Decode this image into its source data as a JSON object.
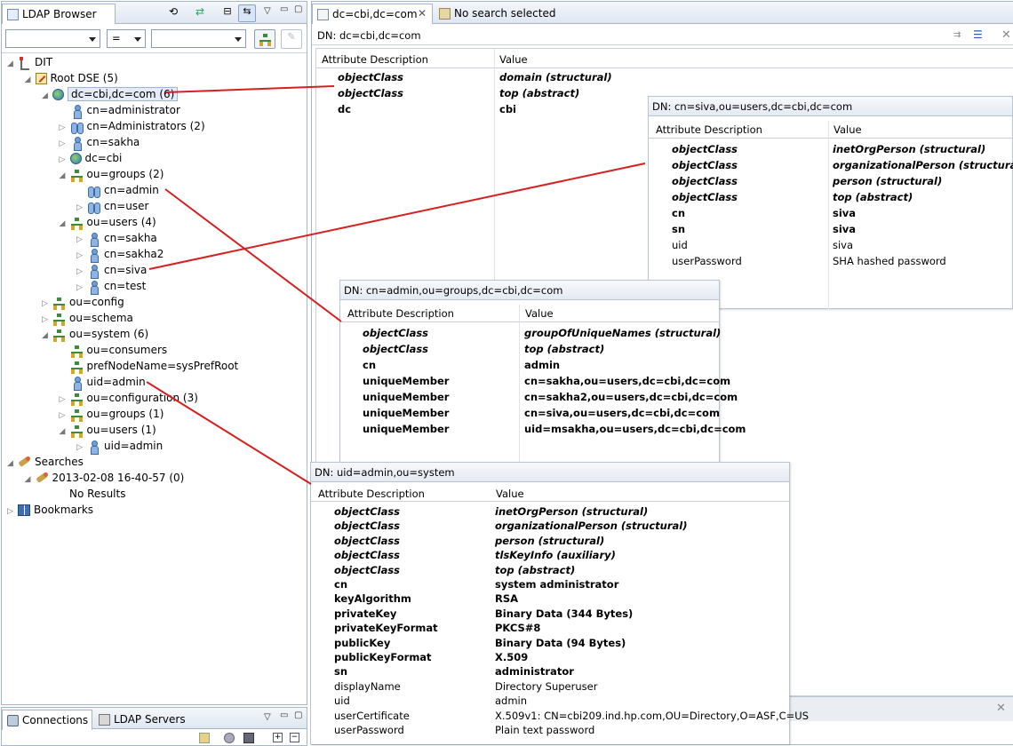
{
  "left_panel": {
    "tab_title": "LDAP Browser",
    "filter_operator": "=",
    "tree": [
      {
        "label": "DIT",
        "level": 0,
        "icon": "dit-icon",
        "expanded": true
      },
      {
        "label": "Root DSE (5)",
        "level": 1,
        "icon": "root-dse-icon",
        "expanded": true
      },
      {
        "label": "dc=cbi,dc=com (6)",
        "level": 2,
        "icon": "globe-icon",
        "expanded": true,
        "selected": true
      },
      {
        "label": "cn=administrator",
        "level": 3,
        "icon": "person-icon"
      },
      {
        "label": "cn=Administrators (2)",
        "level": 3,
        "icon": "group-icon",
        "expandable": true
      },
      {
        "label": "cn=sakha",
        "level": 3,
        "icon": "person-icon",
        "expandable": true
      },
      {
        "label": "dc=cbi",
        "level": 3,
        "icon": "globe-icon",
        "expandable": true
      },
      {
        "label": "ou=groups (2)",
        "level": 3,
        "icon": "ou-icon",
        "expanded": true
      },
      {
        "label": "cn=admin",
        "level": 4,
        "icon": "group-icon"
      },
      {
        "label": "cn=user",
        "level": 4,
        "icon": "group-icon",
        "expandable": true
      },
      {
        "label": "ou=users (4)",
        "level": 3,
        "icon": "ou-icon",
        "expanded": true
      },
      {
        "label": "cn=sakha",
        "level": 4,
        "icon": "person-icon",
        "expandable": true
      },
      {
        "label": "cn=sakha2",
        "level": 4,
        "icon": "person-icon",
        "expandable": true
      },
      {
        "label": "cn=siva",
        "level": 4,
        "icon": "person-icon",
        "expandable": true
      },
      {
        "label": "cn=test",
        "level": 4,
        "icon": "person-icon",
        "expandable": true
      },
      {
        "label": "ou=config",
        "level": 2,
        "icon": "ou-icon",
        "expandable": true
      },
      {
        "label": "ou=schema",
        "level": 2,
        "icon": "ou-icon",
        "expandable": true
      },
      {
        "label": "ou=system (6)",
        "level": 2,
        "icon": "ou-icon",
        "expanded": true
      },
      {
        "label": "ou=consumers",
        "level": 3,
        "icon": "ou-icon"
      },
      {
        "label": "prefNodeName=sysPrefRoot",
        "level": 3,
        "icon": "ou-icon"
      },
      {
        "label": "uid=admin",
        "level": 3,
        "icon": "person-icon"
      },
      {
        "label": "ou=configuration (3)",
        "level": 3,
        "icon": "ou-icon",
        "expandable": true
      },
      {
        "label": "ou=groups (1)",
        "level": 3,
        "icon": "ou-icon",
        "expandable": true
      },
      {
        "label": "ou=users (1)",
        "level": 3,
        "icon": "ou-icon",
        "expanded": true
      },
      {
        "label": "uid=admin",
        "level": 4,
        "icon": "person-icon",
        "expandable": true
      },
      {
        "label": "Searches",
        "level": 0,
        "icon": "search-icon",
        "expanded": true
      },
      {
        "label": "2013-02-08 16-40-57 (0)",
        "level": 1,
        "icon": "search-icon",
        "expanded": true
      },
      {
        "label": "No Results",
        "level": 2,
        "icon": ""
      },
      {
        "label": "Bookmarks",
        "level": 0,
        "icon": "book-icon",
        "expandable": true
      }
    ]
  },
  "bottom_left": {
    "tabs": [
      {
        "label": "Connections"
      },
      {
        "label": "LDAP Servers"
      }
    ]
  },
  "editor": {
    "tabs": [
      {
        "label": "dc=cbi,dc=com"
      },
      {
        "label": "No search selected"
      }
    ]
  },
  "tables": {
    "col_attr": "Attribute Description",
    "col_value": "Value",
    "main": {
      "dn": "DN: dc=cbi,dc=com",
      "rows": [
        {
          "attr": "objectClass",
          "value": "domain (structural)",
          "style": "bi"
        },
        {
          "attr": "objectClass",
          "value": "top (abstract)",
          "style": "bi"
        },
        {
          "attr": "dc",
          "value": "cbi",
          "style": "b"
        }
      ]
    },
    "siva": {
      "dn": "DN: cn=siva,ou=users,dc=cbi,dc=com",
      "rows": [
        {
          "attr": "objectClass",
          "value": "inetOrgPerson (structural)",
          "style": "bi"
        },
        {
          "attr": "objectClass",
          "value": "organizationalPerson (structural)",
          "style": "bi"
        },
        {
          "attr": "objectClass",
          "value": "person (structural)",
          "style": "bi"
        },
        {
          "attr": "objectClass",
          "value": "top (abstract)",
          "style": "bi"
        },
        {
          "attr": "cn",
          "value": "siva",
          "style": "b"
        },
        {
          "attr": "sn",
          "value": "siva",
          "style": "b"
        },
        {
          "attr": "uid",
          "value": "siva",
          "style": ""
        },
        {
          "attr": "userPassword",
          "value": "SHA hashed password",
          "style": ""
        }
      ]
    },
    "admin_group": {
      "dn": "DN: cn=admin,ou=groups,dc=cbi,dc=com",
      "rows": [
        {
          "attr": "objectClass",
          "value": "groupOfUniqueNames (structural)",
          "style": "bi"
        },
        {
          "attr": "objectClass",
          "value": "top (abstract)",
          "style": "bi"
        },
        {
          "attr": "cn",
          "value": "admin",
          "style": "b"
        },
        {
          "attr": "uniqueMember",
          "value": "cn=sakha,ou=users,dc=cbi,dc=com",
          "style": "b"
        },
        {
          "attr": "uniqueMember",
          "value": "cn=sakha2,ou=users,dc=cbi,dc=com",
          "style": "b"
        },
        {
          "attr": "uniqueMember",
          "value": "cn=siva,ou=users,dc=cbi,dc=com",
          "style": "b"
        },
        {
          "attr": "uniqueMember",
          "value": "uid=msakha,ou=users,dc=cbi,dc=com",
          "style": "b"
        }
      ]
    },
    "uid_admin": {
      "dn": "DN: uid=admin,ou=system",
      "rows": [
        {
          "attr": "objectClass",
          "value": "inetOrgPerson (structural)",
          "style": "bi"
        },
        {
          "attr": "objectClass",
          "value": "organizationalPerson (structural)",
          "style": "bi"
        },
        {
          "attr": "objectClass",
          "value": "person (structural)",
          "style": "bi"
        },
        {
          "attr": "objectClass",
          "value": "tlsKeyInfo (auxiliary)",
          "style": "bi"
        },
        {
          "attr": "objectClass",
          "value": "top (abstract)",
          "style": "bi"
        },
        {
          "attr": "cn",
          "value": "system administrator",
          "style": "b"
        },
        {
          "attr": "keyAlgorithm",
          "value": "RSA",
          "style": "b"
        },
        {
          "attr": "privateKey",
          "value": "Binary Data (344 Bytes)",
          "style": "b"
        },
        {
          "attr": "privateKeyFormat",
          "value": "PKCS#8",
          "style": "b"
        },
        {
          "attr": "publicKey",
          "value": "Binary Data (94 Bytes)",
          "style": "b"
        },
        {
          "attr": "publicKeyFormat",
          "value": "X.509",
          "style": "b"
        },
        {
          "attr": "sn",
          "value": "administrator",
          "style": "b"
        },
        {
          "attr": "displayName",
          "value": "Directory Superuser",
          "style": ""
        },
        {
          "attr": "uid",
          "value": "admin",
          "style": ""
        },
        {
          "attr": "userCertificate",
          "value": "X.509v1: CN=cbi209.ind.hp.com,OU=Directory,O=ASF,C=US",
          "style": ""
        },
        {
          "attr": "userPassword",
          "value": "Plain text password",
          "style": ""
        }
      ]
    }
  },
  "colors": {
    "annotation_line": "#d42020",
    "panel_border": "#a7b6c8"
  }
}
